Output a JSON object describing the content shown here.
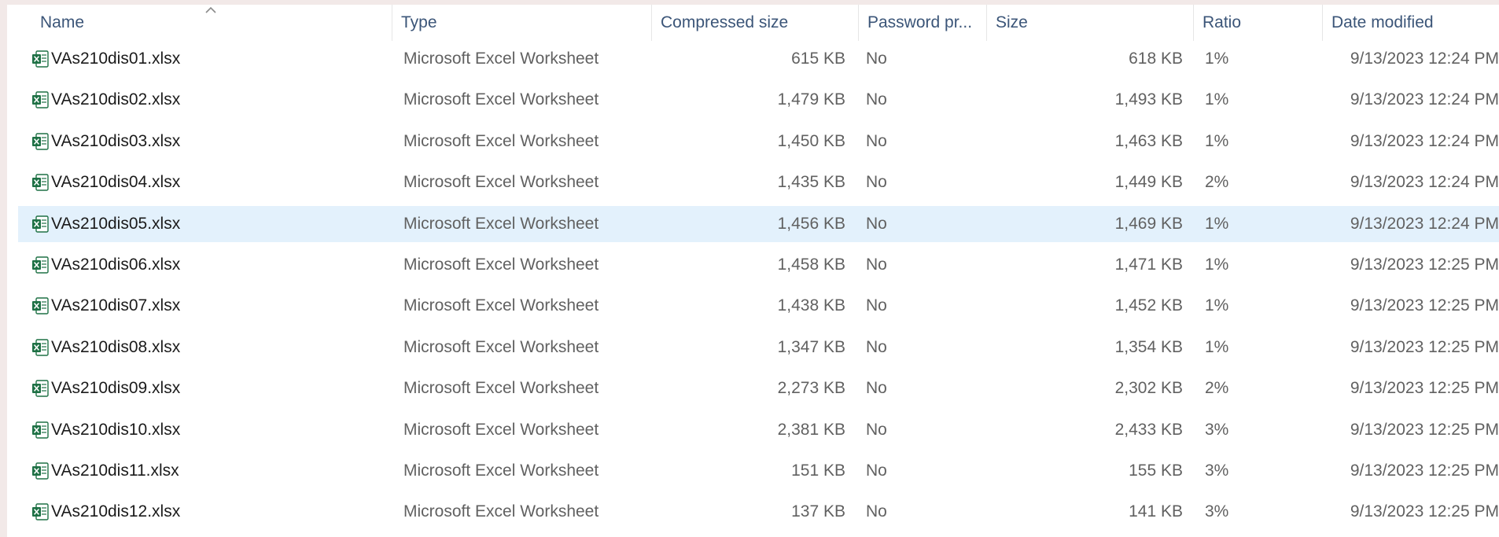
{
  "columns": {
    "name": "Name",
    "type": "Type",
    "compressed_size": "Compressed size",
    "password": "Password pr...",
    "size": "Size",
    "ratio": "Ratio",
    "date_modified": "Date modified"
  },
  "icon": "excel-file-icon",
  "colors": {
    "selected_row": "#e3f1fc",
    "header_text": "#3b5578",
    "excel_green": "#1e7145"
  },
  "selected_index": 4,
  "rows": [
    {
      "name": "VAs210dis01.xlsx",
      "type": "Microsoft Excel Worksheet",
      "compressed": "615 KB",
      "password": "No",
      "size": "618 KB",
      "ratio": "1%",
      "date": "9/13/2023 12:24 PM"
    },
    {
      "name": "VAs210dis02.xlsx",
      "type": "Microsoft Excel Worksheet",
      "compressed": "1,479 KB",
      "password": "No",
      "size": "1,493 KB",
      "ratio": "1%",
      "date": "9/13/2023 12:24 PM"
    },
    {
      "name": "VAs210dis03.xlsx",
      "type": "Microsoft Excel Worksheet",
      "compressed": "1,450 KB",
      "password": "No",
      "size": "1,463 KB",
      "ratio": "1%",
      "date": "9/13/2023 12:24 PM"
    },
    {
      "name": "VAs210dis04.xlsx",
      "type": "Microsoft Excel Worksheet",
      "compressed": "1,435 KB",
      "password": "No",
      "size": "1,449 KB",
      "ratio": "2%",
      "date": "9/13/2023 12:24 PM"
    },
    {
      "name": "VAs210dis05.xlsx",
      "type": "Microsoft Excel Worksheet",
      "compressed": "1,456 KB",
      "password": "No",
      "size": "1,469 KB",
      "ratio": "1%",
      "date": "9/13/2023 12:24 PM"
    },
    {
      "name": "VAs210dis06.xlsx",
      "type": "Microsoft Excel Worksheet",
      "compressed": "1,458 KB",
      "password": "No",
      "size": "1,471 KB",
      "ratio": "1%",
      "date": "9/13/2023 12:25 PM"
    },
    {
      "name": "VAs210dis07.xlsx",
      "type": "Microsoft Excel Worksheet",
      "compressed": "1,438 KB",
      "password": "No",
      "size": "1,452 KB",
      "ratio": "1%",
      "date": "9/13/2023 12:25 PM"
    },
    {
      "name": "VAs210dis08.xlsx",
      "type": "Microsoft Excel Worksheet",
      "compressed": "1,347 KB",
      "password": "No",
      "size": "1,354 KB",
      "ratio": "1%",
      "date": "9/13/2023 12:25 PM"
    },
    {
      "name": "VAs210dis09.xlsx",
      "type": "Microsoft Excel Worksheet",
      "compressed": "2,273 KB",
      "password": "No",
      "size": "2,302 KB",
      "ratio": "2%",
      "date": "9/13/2023 12:25 PM"
    },
    {
      "name": "VAs210dis10.xlsx",
      "type": "Microsoft Excel Worksheet",
      "compressed": "2,381 KB",
      "password": "No",
      "size": "2,433 KB",
      "ratio": "3%",
      "date": "9/13/2023 12:25 PM"
    },
    {
      "name": "VAs210dis11.xlsx",
      "type": "Microsoft Excel Worksheet",
      "compressed": "151 KB",
      "password": "No",
      "size": "155 KB",
      "ratio": "3%",
      "date": "9/13/2023 12:25 PM"
    },
    {
      "name": "VAs210dis12.xlsx",
      "type": "Microsoft Excel Worksheet",
      "compressed": "137 KB",
      "password": "No",
      "size": "141 KB",
      "ratio": "3%",
      "date": "9/13/2023 12:25 PM"
    }
  ]
}
